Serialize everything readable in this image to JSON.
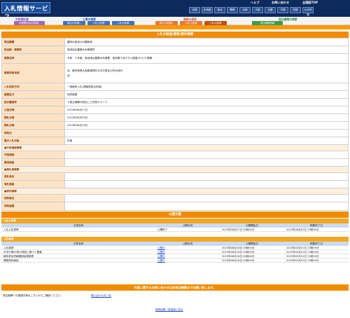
{
  "header": {
    "title": "入札情報サービス",
    "util": {
      "help": "ヘルプ",
      "contact": "お問い合わせ",
      "national": "全国版TOP"
    },
    "regions": [
      "全国",
      "北海道",
      "東北",
      "関東",
      "北陸",
      "中部",
      "近畿",
      "中国",
      "四国",
      "九州沖縄"
    ]
  },
  "catnav": {
    "cat1": {
      "title": "中長期計画",
      "tabs": [
        "中長期計画の見通し"
      ]
    },
    "cat2": {
      "title": "工事の検索",
      "tabs": [
        "発注の見通し",
        "入札公告等",
        "入札の結果"
      ]
    },
    "cat3": {
      "title": "業務の検索",
      "tabs": [
        "発注の見通し",
        "入札公告等",
        "入札の結果"
      ]
    },
    "cat4": {
      "title": "発注機関の検索",
      "tabs": [
        "発注機関情報"
      ]
    }
  },
  "detail": {
    "title": "入札の経過(業務)案件概要",
    "rows": [
      {
        "label": "発注機関",
        "values": [
          "農林水産省九州農政局"
        ]
      },
      {
        "label": "担当部・事務所",
        "values": [
          "菊池地区農業水利事業所"
        ]
      },
      {
        "label": "業務名称",
        "values": [
          "令和　５年度　菊池地区農業水利事業　菊池第２地下ダム調査(その２)業務"
        ]
      },
      {
        "label": "業務対象地域",
        "values": [
          "自：鹿児島県大島郡喜界町大字中里及び荒木地内",
          "至："
        ]
      },
      {
        "label": "入札契約方式",
        "values": [
          "一般競争入札(简略型総合評価)"
        ]
      },
      {
        "label": "業務区分",
        "values": [
          "地質調査"
        ]
      },
      {
        "label": "設計書番号",
        "values": [
          "＊発注機関が設定した任意のコード"
        ]
      },
      {
        "label": "公告日時",
        "values": [
          "2023年06月27日"
        ]
      },
      {
        "label": "開札日時",
        "values": [
          "2023年08月03日"
        ]
      },
      {
        "label": "開札日時",
        "values": [
          "2023年08月03日"
        ]
      },
      {
        "label": "契約日",
        "values": [
          ""
        ]
      },
      {
        "label": "電子入札対象",
        "values": [
          "対象"
        ]
      }
    ],
    "planned_section": "■予定価格情報",
    "planned_rows": [
      {
        "label": "予定価格",
        "value": ""
      },
      {
        "label": "最低価格",
        "value": ""
      }
    ],
    "winner_section": "■落札者情報",
    "winner_rows": [
      {
        "label": "落札者名",
        "value": ""
      },
      {
        "label": "落札価格",
        "value": ""
      }
    ],
    "contract_section": "■契約情報",
    "contract_rows": [
      {
        "label": "契約者名",
        "value": ""
      },
      {
        "label": "契約金額",
        "value": ""
      }
    ]
  },
  "documents": {
    "title": "公開文書",
    "headers": [
      "文書名称",
      "公開状況",
      "公開開始日",
      "掲載終了日"
    ],
    "groups": [
      {
        "name": "入札公告等",
        "rows": [
          {
            "name": "入札公告書等",
            "status": "公開終了",
            "start": "2023年06月27日 00時00分",
            "end": "2023年08月03日 23時59分",
            "link": false
          }
        ]
      },
      {
        "name": "入札経過",
        "rows": [
          {
            "name": "入札調書",
            "status": "公開中",
            "start": "2023年08月18日 00時00分",
            "end": "2025年03月31日 23時59分",
            "link": true
          },
          {
            "name": "予決令第85条の規定に基づく審査",
            "status": "公開中",
            "start": "2023年08月18日 00時00分",
            "end": "2025年03月31日 23時59分",
            "link": true
          },
          {
            "name": "競争参加資格確認結果調書",
            "status": "公開中",
            "start": "2023年08月18日 00時00分",
            "end": "2025年03月31日 23時59分",
            "link": true
          },
          {
            "name": "業務契約締結",
            "status": "公開中",
            "start": "2023年08月18日 00時00分",
            "end": "2025年03月31日 23時59分",
            "link": true
          }
        ]
      }
    ]
  },
  "contact": {
    "title": "内容に関するお問い合わせは各発注機関までお願い致します。",
    "text": "発注機関への連絡先等はこちらからご確認ください。",
    "link": "問い合わせ先一覧"
  },
  "footer": {
    "back_link": "検索結果一覧画面に戻る"
  },
  "colors": {
    "navy": "#0d2a5c",
    "orange": "#f08c00",
    "label_bg": "#fde3c6",
    "link": "#1a3fbf"
  }
}
